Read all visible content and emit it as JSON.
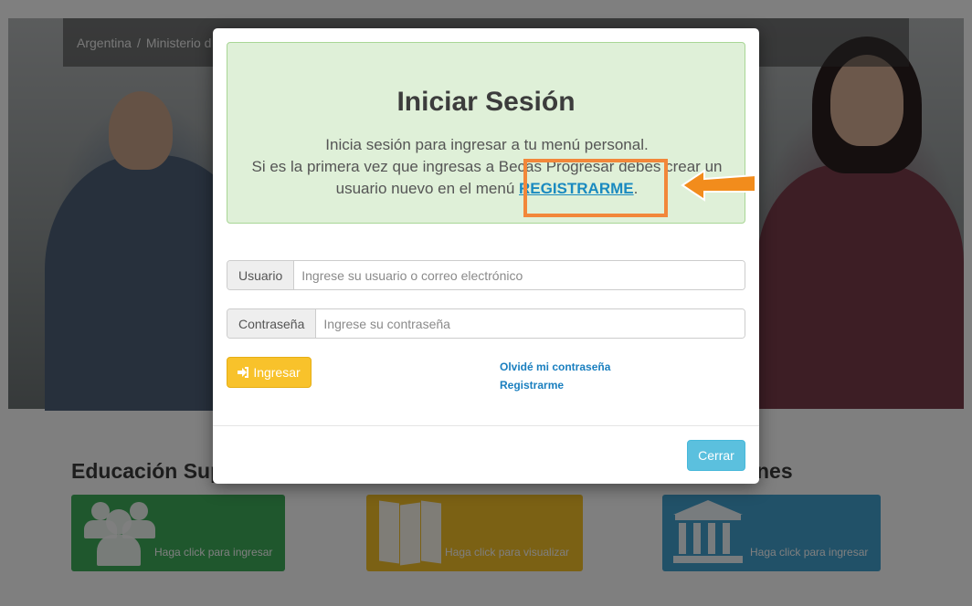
{
  "breadcrumb": {
    "items": [
      "Argentina",
      "/",
      "Ministerio d"
    ]
  },
  "sections": {
    "left_title": "Educación Sup",
    "right_title": "nes",
    "cards": [
      {
        "text": "Haga click para ingresar",
        "icon": "users-icon",
        "color": "#3fae5b"
      },
      {
        "text": "Haga click para visualizar",
        "icon": "map-icon",
        "color": "#f7c229"
      },
      {
        "text": "Haga click para ingresar",
        "icon": "bank-icon",
        "color": "#43a2d0"
      }
    ]
  },
  "modal": {
    "title": "Iniciar Sesión",
    "line1": "Inicia sesión para ingresar a tu menú personal.",
    "line2_pre": "Si es la primera vez que ingresas a Becas Progresar debes crear un usuario nuevo en el menú ",
    "line2_link": "REGISTRARME",
    "line2_post": ".",
    "highlight_color": "#f2873a",
    "user_label": "Usuario",
    "user_placeholder": "Ingrese su usuario o correo electrónico",
    "password_label": "Contraseña",
    "password_placeholder": "Ingrese su contraseña",
    "login_button": "Ingresar",
    "login_icon": "sign-in-icon",
    "forgot_link": "Olvidé mi contraseña",
    "register_link": "Registrarme",
    "close_button": "Cerrar"
  }
}
